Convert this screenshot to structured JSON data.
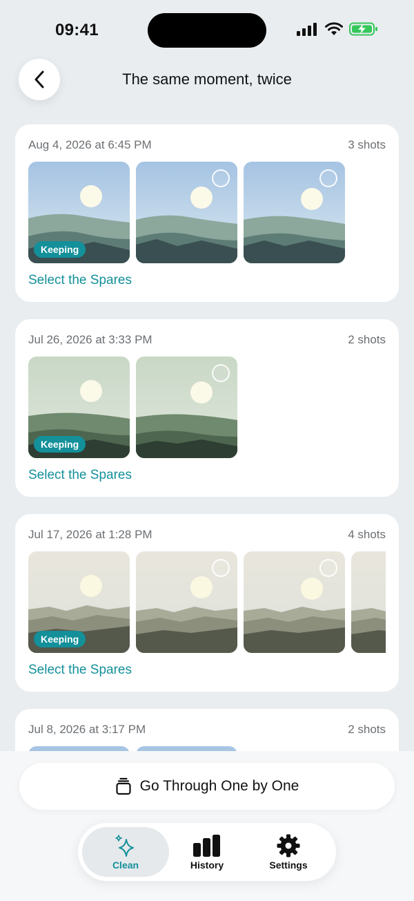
{
  "status_bar": {
    "time": "09:41"
  },
  "header": {
    "title": "The same moment, twice"
  },
  "groups": [
    {
      "date": "Aug 4, 2026 at 6:45 PM",
      "count": "3 shots",
      "badge": "Keeping",
      "action": "Select the Spares"
    },
    {
      "date": "Jul 26, 2026 at 3:33 PM",
      "count": "2 shots",
      "badge": "Keeping",
      "action": "Select the Spares"
    },
    {
      "date": "Jul 17, 2026 at 1:28 PM",
      "count": "4 shots",
      "badge": "Keeping",
      "action": "Select the Spares"
    },
    {
      "date": "Jul 8, 2026 at 3:17 PM",
      "count": "2 shots"
    }
  ],
  "bottom": {
    "one_by_one_label": "Go Through One by One"
  },
  "tabs": [
    {
      "label": "Clean",
      "icon": "sparkles-icon",
      "active": true
    },
    {
      "label": "History",
      "icon": "bar-chart-icon",
      "active": false
    },
    {
      "label": "Settings",
      "icon": "gear-icon",
      "active": false
    }
  ],
  "colors": {
    "accent": "#13909a",
    "background": "#e9edf0"
  }
}
